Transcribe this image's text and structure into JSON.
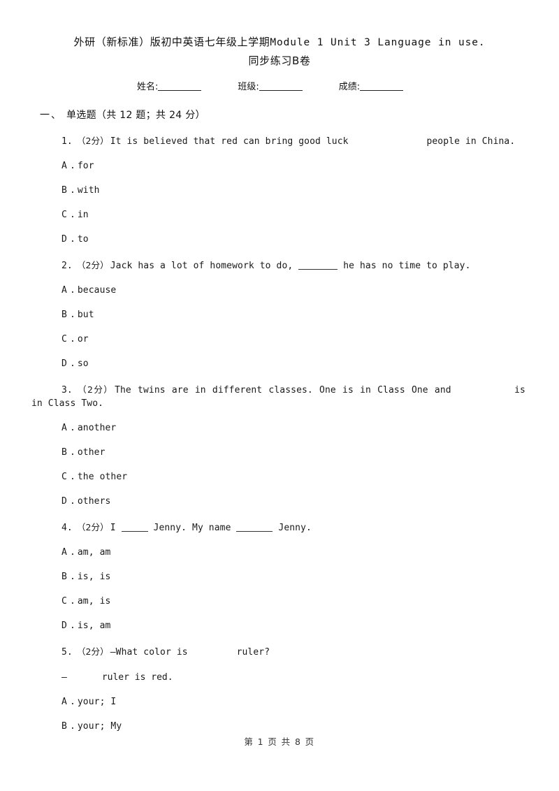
{
  "document": {
    "title_line1_cn": "外研（新标准）版初中英语七年级上学期",
    "title_line1_en": "Module 1 Unit 3 Language in use.",
    "title_line2": "同步练习B卷"
  },
  "info": {
    "name_label": "姓名:",
    "class_label": "班级:",
    "score_label": "成绩:"
  },
  "section": {
    "number": "一、",
    "title": "单选题（共 12 题；共 24 分）"
  },
  "questions": [
    {
      "number": "1.",
      "score": "（2分）",
      "stem_before": "It is believed that red can bring good luck",
      "blank_type": "gap",
      "blank_width": 96,
      "stem_after": "people in China.",
      "options": [
        {
          "letter": "A",
          "dot": ".",
          "text": "for"
        },
        {
          "letter": "B",
          "dot": ".",
          "text": "with"
        },
        {
          "letter": "C",
          "dot": ".",
          "text": "in"
        },
        {
          "letter": "D",
          "dot": ".",
          "text": "to"
        }
      ]
    },
    {
      "number": "2.",
      "score": "（2分）",
      "stem_before": "Jack has a lot of homework to do,",
      "blank_type": "underline",
      "blank_width": 56,
      "stem_after": "he has no time to play.",
      "options": [
        {
          "letter": "A",
          "dot": ".",
          "text": "because"
        },
        {
          "letter": "B",
          "dot": ".",
          "text": "but"
        },
        {
          "letter": "C",
          "dot": ".",
          "text": "or"
        },
        {
          "letter": "D",
          "dot": ".",
          "text": "so"
        }
      ]
    },
    {
      "number": "3.",
      "score": "（2分）",
      "stem_before": "The twins are in different classes. One is in Class One and",
      "blank_type": "gap",
      "blank_width": 72,
      "stem_after": "is in Class Two.",
      "options": [
        {
          "letter": "A",
          "dot": ".",
          "text": "another"
        },
        {
          "letter": "B",
          "dot": ".",
          "text": "other"
        },
        {
          "letter": "C",
          "dot": ".",
          "text": "the other"
        },
        {
          "letter": "D",
          "dot": ".",
          "text": "others"
        }
      ]
    },
    {
      "number": "4.",
      "score": "（2分）",
      "stem_before": "I",
      "blank_type": "underline",
      "blank_width": 38,
      "stem_mid": "Jenny. My name",
      "blank2_type": "underline",
      "blank2_width": 52,
      "stem_after": "Jenny.",
      "options": [
        {
          "letter": "A",
          "dot": ".",
          "text": "am, am"
        },
        {
          "letter": "B",
          "dot": ".",
          "text": "is, is"
        },
        {
          "letter": "C",
          "dot": ".",
          "text": "am, is"
        },
        {
          "letter": "D",
          "dot": ".",
          "text": "is, am"
        }
      ]
    },
    {
      "number": "5.",
      "score": "（2分）",
      "stem_before": "—What color is",
      "blank_type": "gap",
      "blank_width": 54,
      "stem_after": "ruler?",
      "reply_dash": "—",
      "reply_blank_width": 50,
      "reply_text": "ruler is red.",
      "options": [
        {
          "letter": "A",
          "dot": ".",
          "text": "your; I"
        },
        {
          "letter": "B",
          "dot": ".",
          "text": "your; My"
        }
      ]
    }
  ],
  "footer": {
    "text": "第 1 页 共 8 页"
  }
}
